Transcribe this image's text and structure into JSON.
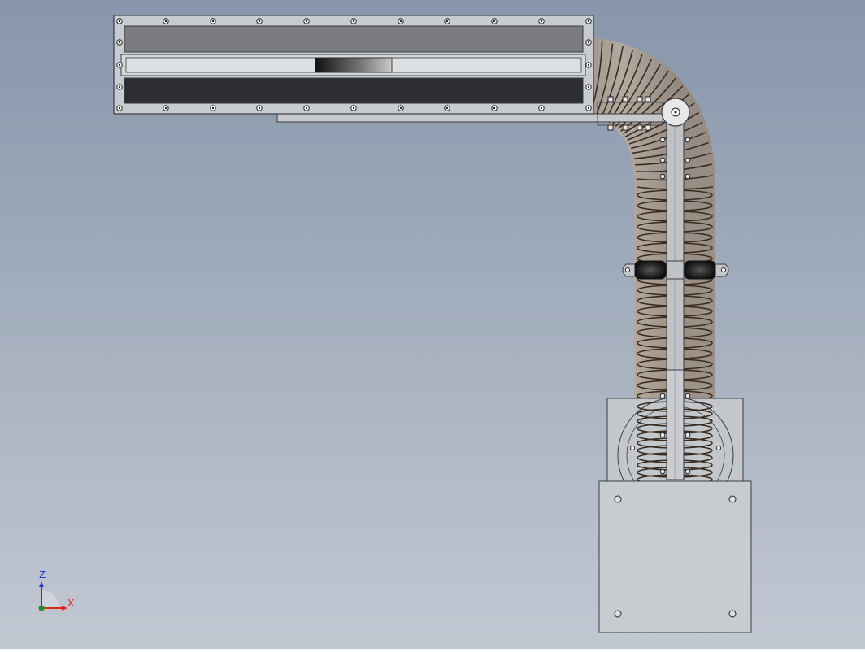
{
  "viewport": {
    "background_top": "#8796ab",
    "background_bottom": "#c2c8d2"
  },
  "colors": {
    "panel_fill": "#c8cbcf",
    "panel_stroke": "#3a3d42",
    "dark_slot": "#2c2e31",
    "grey_slot": "#7a7c80",
    "hose_fill": "#b9a48d",
    "spring": "#3a2b20",
    "steel": "#b9bdc2",
    "axis_x": "#e0241f",
    "axis_y": "#2a8d2a",
    "axis_z": "#1f3fd8"
  },
  "triad": {
    "x_label": "X",
    "z_label": "Z",
    "x_icon": "x-axis-arrow-icon",
    "z_icon": "z-axis-arrow-icon",
    "y_icon": "y-axis-dot-icon"
  }
}
